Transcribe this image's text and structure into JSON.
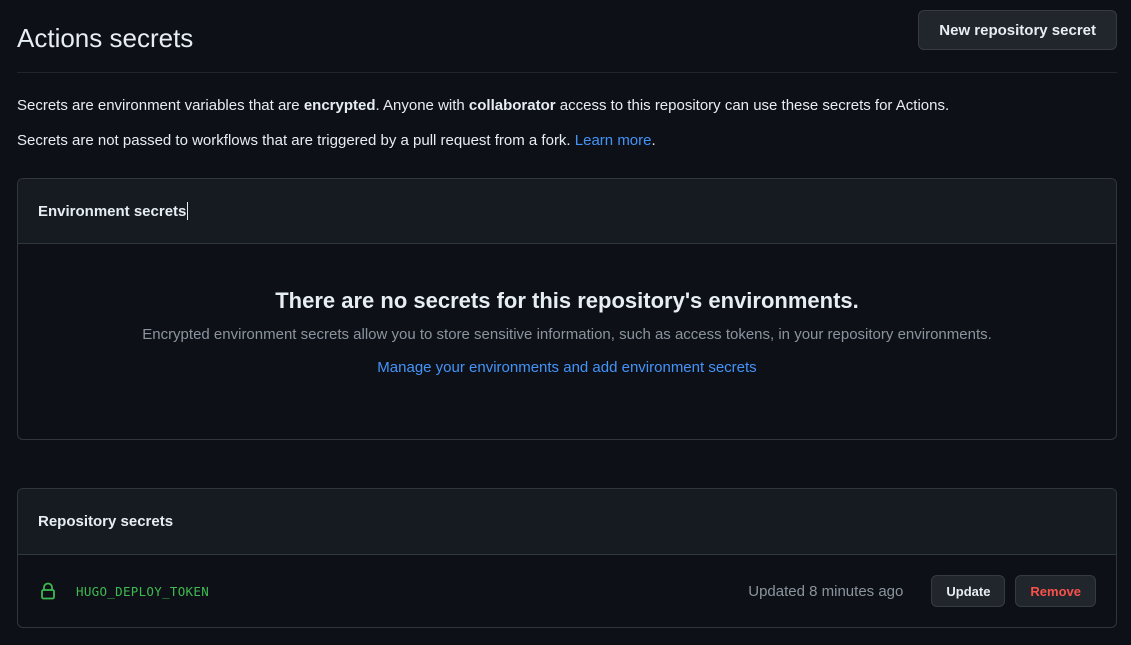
{
  "header": {
    "title": "Actions secrets",
    "new_secret_label": "New repository secret"
  },
  "description": {
    "line1_a": "Secrets are environment variables that are ",
    "line1_b": "encrypted",
    "line1_c": ". Anyone with ",
    "line1_d": "collaborator",
    "line1_e": " access to this repository can use these secrets for Actions.",
    "line2_a": "Secrets are not passed to workflows that are triggered by a pull request from a fork. ",
    "line2_link": "Learn more",
    "line2_end": "."
  },
  "environment_secrets": {
    "heading": "Environment secrets",
    "blank_title": "There are no secrets for this repository's environments.",
    "blank_text": "Encrypted environment secrets allow you to store sensitive information, such as access tokens, in your repository environments.",
    "manage_link": "Manage your environments and add environment secrets"
  },
  "repository_secrets": {
    "heading": "Repository secrets",
    "items": [
      {
        "icon": "lock-icon",
        "name": "HUGO_DEPLOY_TOKEN",
        "updated": "Updated 8 minutes ago",
        "update_label": "Update",
        "remove_label": "Remove"
      }
    ]
  },
  "colors": {
    "background": "#0d1117",
    "link": "#4493f8",
    "secret_name": "#3fb950",
    "danger": "#f85149"
  }
}
